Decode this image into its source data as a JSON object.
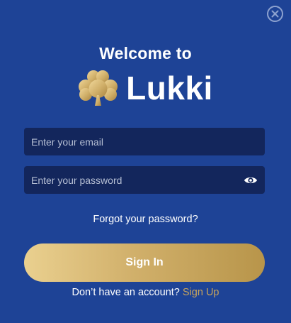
{
  "dialog": {
    "welcome_text": "Welcome to",
    "brand_name": "Lukki",
    "email_placeholder": "Enter your email",
    "password_placeholder": "Enter your password",
    "forgot_password": "Forgot your password?",
    "sign_in_label": "Sign In",
    "no_account_text": "Don’t have an account?",
    "sign_up_link": "Sign Up"
  },
  "icons": {
    "close": "close-icon",
    "clover": "clover-logo-icon",
    "eye": "eye-icon"
  },
  "colors": {
    "background": "#1e4396",
    "field_background": "#13265c",
    "gold_start": "#ead08f",
    "gold_end": "#b8954a",
    "link_gold": "#c9a55c"
  }
}
